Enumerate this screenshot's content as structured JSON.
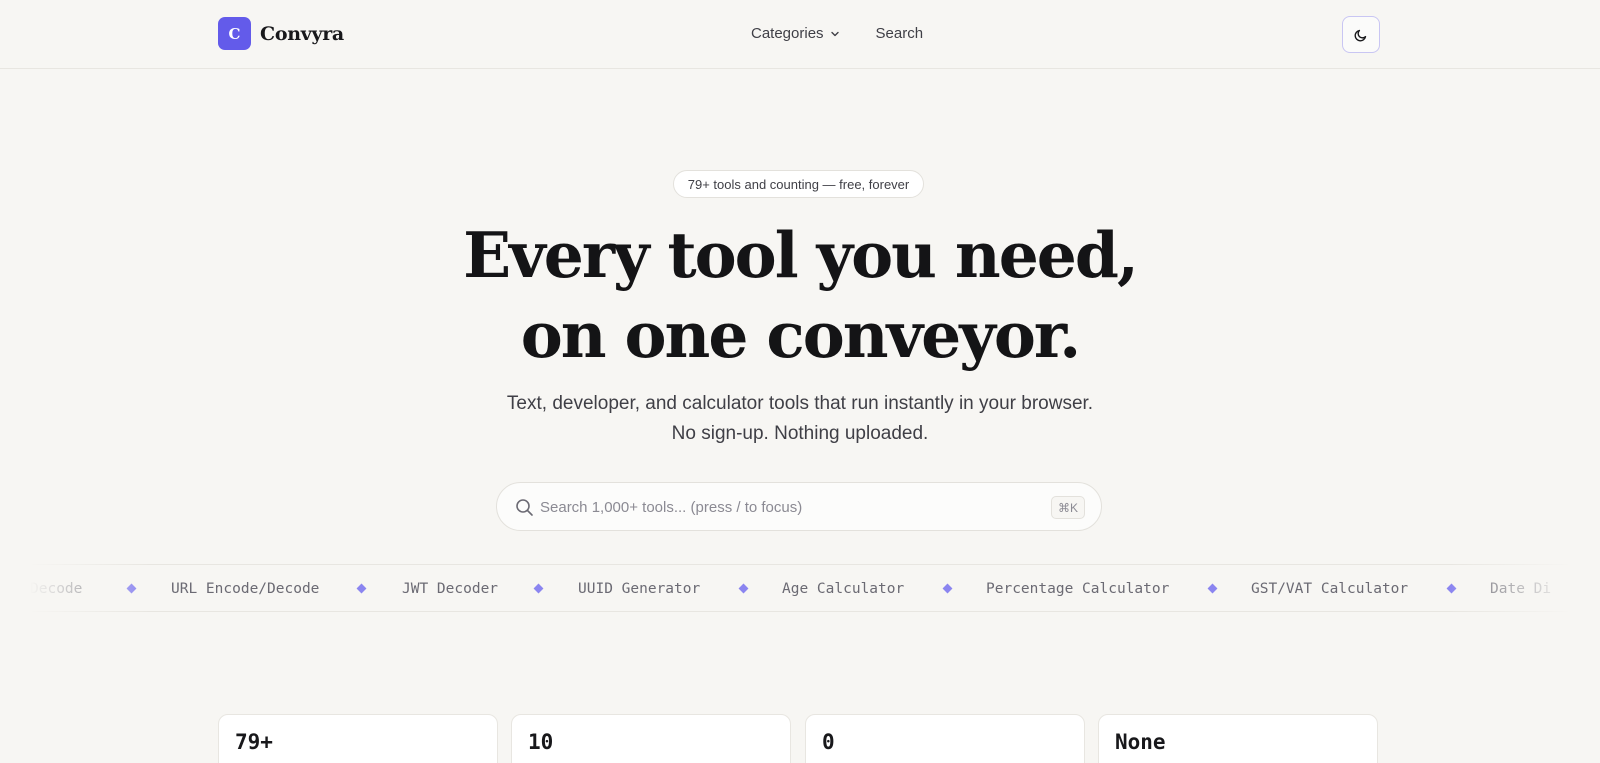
{
  "brand": {
    "mark": "C",
    "name": "Convyra",
    "accent": "#635bea"
  },
  "nav": {
    "items": [
      {
        "label": "Categories",
        "icon": "chevron-down-icon"
      },
      {
        "label": "Search"
      }
    ],
    "theme_toggle_icon": "moon-icon"
  },
  "hero": {
    "badge": "79+ tools and counting — free, forever",
    "headline_line1": "Every tool you need,",
    "headline_line2": "on one conveyor.",
    "subtitle_line1": "Text, developer, and calculator tools that run instantly in your browser.",
    "subtitle_line2": "No sign-up. Nothing uploaded."
  },
  "search": {
    "placeholder": "Search 1,000+ tools... (press / to focus)",
    "value": "",
    "shortcut": "⌘K"
  },
  "ticker": {
    "items": [
      "Decode",
      "URL Encode/Decode",
      "JWT Decoder",
      "UUID Generator",
      "Age Calculator",
      "Percentage Calculator",
      "GST/VAT Calculator",
      "Date Di"
    ]
  },
  "stats": [
    {
      "value": "79+",
      "label": ""
    },
    {
      "value": "10",
      "label": ""
    },
    {
      "value": "0",
      "label": ""
    },
    {
      "value": "None",
      "label": ""
    }
  ]
}
